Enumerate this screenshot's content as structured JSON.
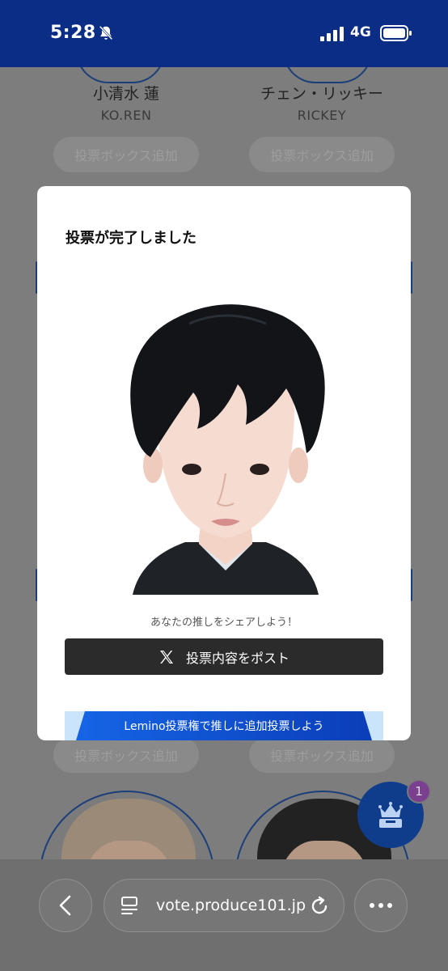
{
  "status_bar": {
    "time": "5:28",
    "network": "4G"
  },
  "members_top": [
    {
      "name": "小清水 蓮",
      "romaji": "KO.REN",
      "vote_button": "投票ボックス追加"
    },
    {
      "name": "チェン・リッキー",
      "romaji": "RICKEY",
      "vote_button": "投票ボックス追加"
    }
  ],
  "members_bottom": [
    {
      "vote_button": "投票ボックス追加"
    },
    {
      "vote_button": "投票ボックス追加"
    }
  ],
  "modal": {
    "title": "投票が完了しました",
    "share_prompt": "あなたの推しをシェアしよう！",
    "post_button": "投票内容をポスト",
    "lemino_banner": "Lemino投票権で推しに追加投票しよう"
  },
  "ranking_badge": "1",
  "browser": {
    "url": "vote.produce101.jp"
  },
  "colors": {
    "brand": "#0b2d86",
    "accent": "#1565e6",
    "badge": "#7b3f8f"
  },
  "icons": [
    "bell-slash-icon",
    "signal-icon",
    "battery-icon",
    "x-logo-icon",
    "crown-ballot-icon",
    "back-icon",
    "tabs-icon",
    "reload-icon",
    "more-icon"
  ]
}
